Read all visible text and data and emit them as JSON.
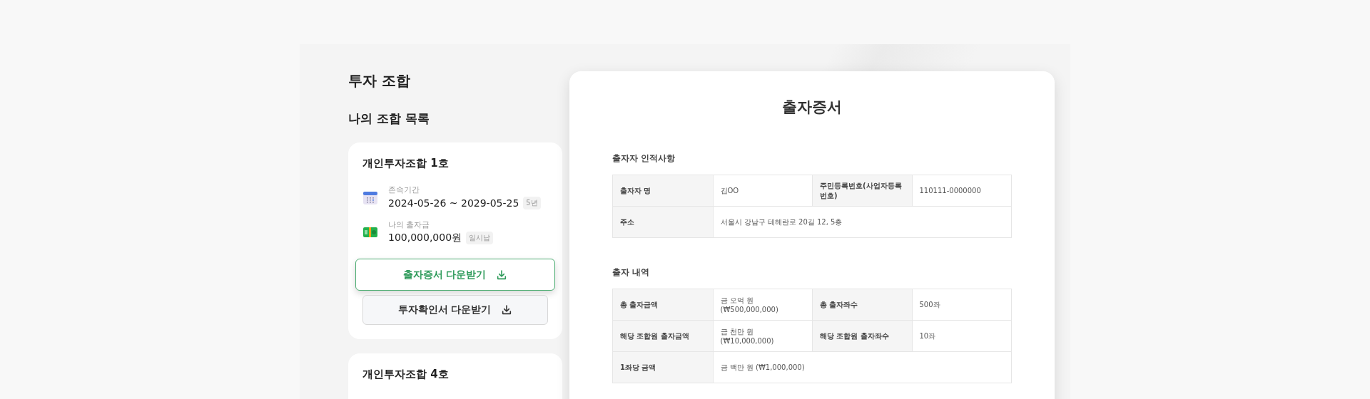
{
  "page_title": "투자 조합",
  "list_title": "나의 조합 목록",
  "funds": [
    {
      "name": "개인투자조합 1호",
      "details": [
        {
          "kind": "period",
          "label": "존속기간",
          "value": "2024-05-26 ~ 2029-05-25",
          "badge": "5년"
        },
        {
          "kind": "amount",
          "label": "나의 출자금",
          "value": "100,000,000원",
          "badge": "일시납"
        }
      ],
      "buttons": [
        {
          "label": "출자증서 다운받기",
          "highlighted": true
        },
        {
          "label": "투자확인서 다운받기",
          "highlighted": false
        }
      ]
    },
    {
      "name": "개인투자조합 4호"
    }
  ],
  "document": {
    "title": "출자증서",
    "sections": [
      {
        "heading": "출자자 인적사항",
        "rows": [
          [
            {
              "kind": "label",
              "text": "출자자 명"
            },
            {
              "kind": "value",
              "text": "김OO"
            },
            {
              "kind": "label",
              "text": "주민등록번호(사업자등록번호)"
            },
            {
              "kind": "value",
              "text": "110111-0000000"
            }
          ],
          [
            {
              "kind": "label",
              "text": "주소"
            },
            {
              "kind": "value",
              "text": "서울시 강남구 테헤란로 20길 12, 5층"
            }
          ]
        ]
      },
      {
        "heading": "출자 내역",
        "rows": [
          [
            {
              "kind": "label",
              "text": "총 출자금액"
            },
            {
              "kind": "value",
              "text": "금 오억 원 (₩500,000,000)"
            },
            {
              "kind": "label",
              "text": "총 출자좌수"
            },
            {
              "kind": "value",
              "text": "500좌"
            }
          ],
          [
            {
              "kind": "label",
              "text": "해당 조합원 출자금액"
            },
            {
              "kind": "value",
              "text": "금 천만 원 (₩10,000,000)"
            },
            {
              "kind": "label",
              "text": "해당 조합원 출자좌수"
            },
            {
              "kind": "value",
              "text": "10좌"
            }
          ],
          [
            {
              "kind": "label",
              "text": "1좌당 금액"
            },
            {
              "kind": "value",
              "text": "금 백만 원 (₩1,000,000)"
            }
          ]
        ]
      }
    ]
  }
}
